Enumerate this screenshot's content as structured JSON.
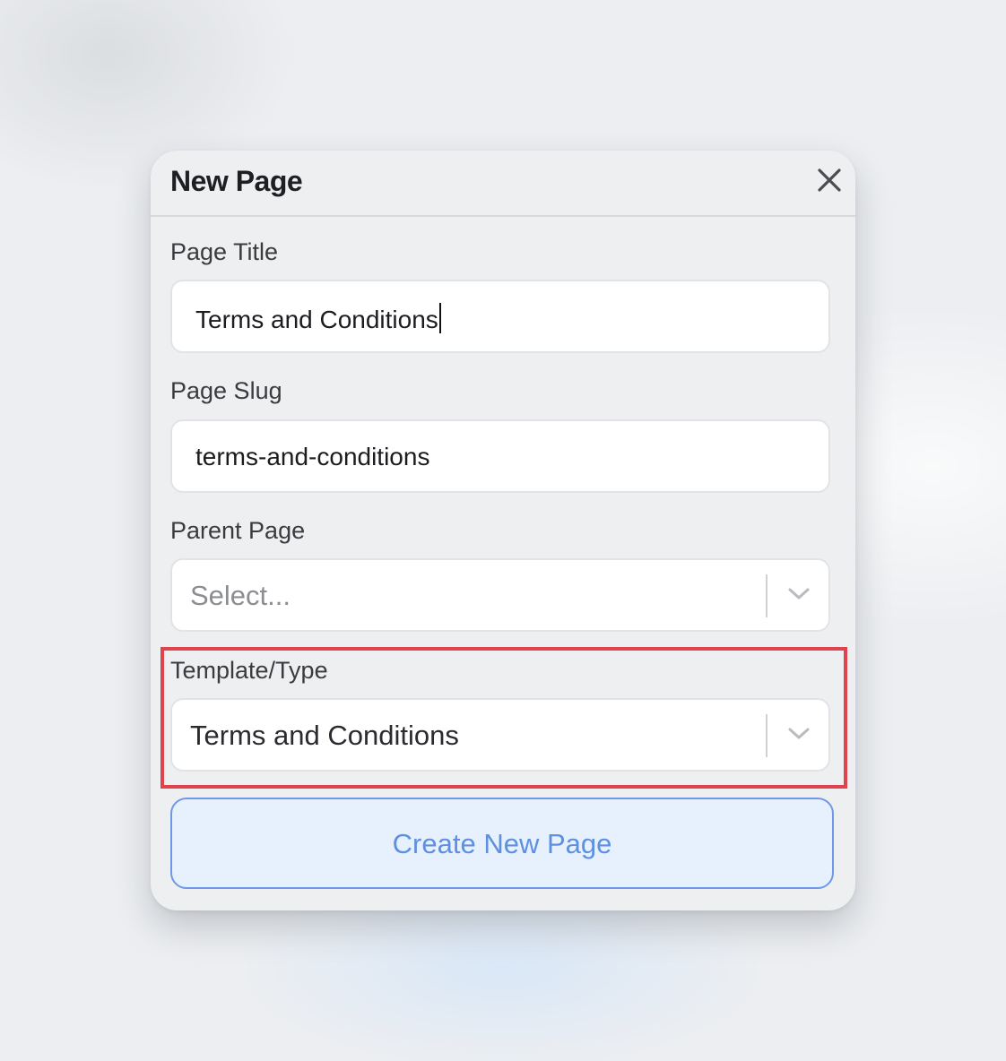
{
  "dialog": {
    "title": "New Page",
    "close_icon": "close-icon"
  },
  "fields": {
    "page_title": {
      "label": "Page Title",
      "value": "Terms and Conditions"
    },
    "page_slug": {
      "label": "Page Slug",
      "value": "terms-and-conditions"
    },
    "parent_page": {
      "label": "Parent Page",
      "placeholder": "Select...",
      "icon": "chevron-down-icon"
    },
    "template_type": {
      "label": "Template/Type",
      "selected": "Terms and Conditions",
      "icon": "chevron-down-icon",
      "highlighted": true,
      "highlight_color": "#e0434c"
    }
  },
  "actions": {
    "create_label": "Create New Page",
    "create_color": "#5f8fe0"
  }
}
